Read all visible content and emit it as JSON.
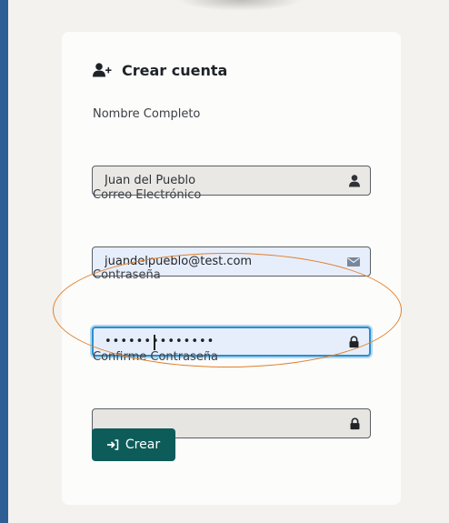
{
  "form": {
    "title": "Crear cuenta",
    "title_icon": "user-plus-icon",
    "fields": [
      {
        "label": "Nombre Completo",
        "value": "Juan del Pueblo",
        "type": "text",
        "icon": "user-icon"
      },
      {
        "label": "Correo Electrónico",
        "value": "juandelpueblo@test.com",
        "type": "email",
        "icon": "envelope-icon"
      },
      {
        "label": "Contraseña",
        "value": "••••••••••••••",
        "type": "password",
        "icon": "lock-icon",
        "focused": true
      },
      {
        "label": "Confirme Contraseña",
        "value": "",
        "type": "password",
        "icon": "lock-icon"
      }
    ],
    "submit_label": "Crear",
    "submit_icon": "sign-in-icon"
  },
  "colors": {
    "page_background": "#2e5f94",
    "content_background": "#f3f2ee",
    "card_background": "#fcfcfb",
    "button": "#0d5c5a",
    "focus_ring": "#2a8fd2",
    "annotation": "#e07f2a"
  }
}
